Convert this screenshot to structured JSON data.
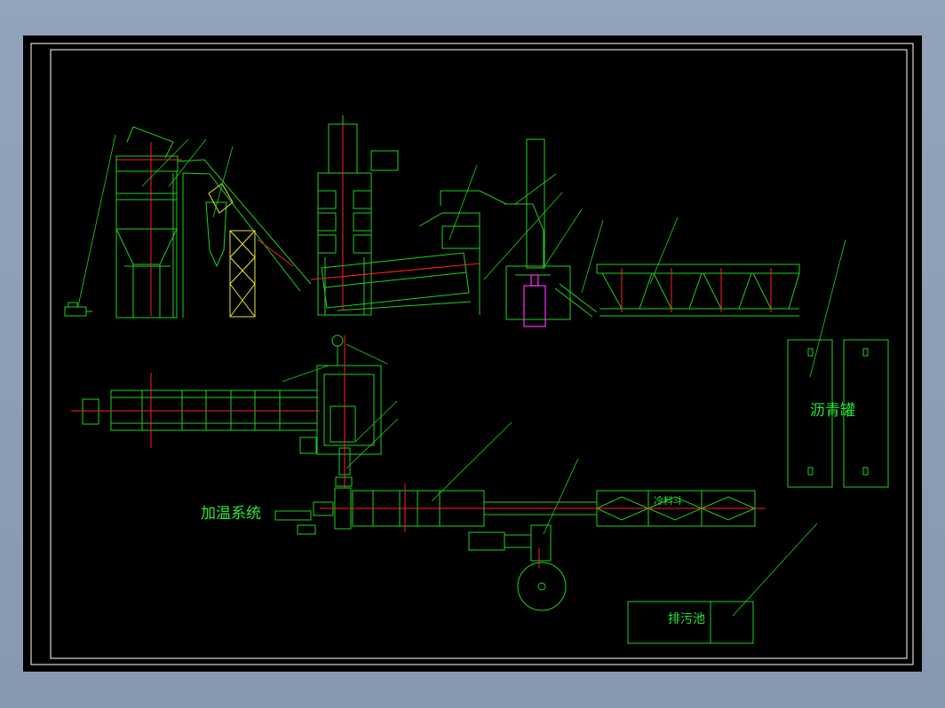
{
  "labels": {
    "heating_system": "加温系统",
    "asphalt_tank": "沥青罐",
    "cold_hopper": "冷料斗",
    "sewage_pool": "排污池"
  },
  "colors": {
    "background": "#000000",
    "frame": "#ffffff",
    "line_green": "#1fd11f",
    "line_red": "#ff2020",
    "line_yellow": "#e8e830",
    "line_magenta": "#ff30ff",
    "text_green": "#26e83a"
  }
}
